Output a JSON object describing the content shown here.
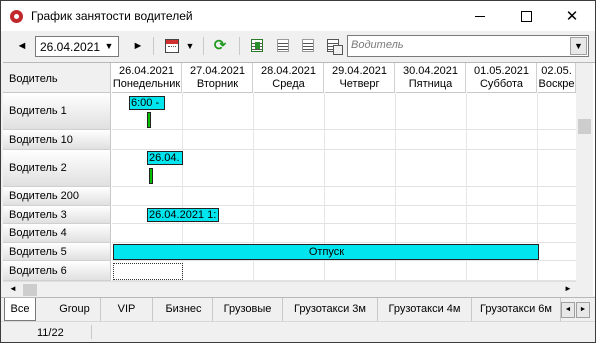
{
  "window": {
    "title": "График занятости водителей",
    "controls": {
      "minimize": "–",
      "maximize": "☐",
      "close": "✕"
    }
  },
  "toolbar": {
    "prev_label": "◄",
    "next_label": "►",
    "date_value": "26.04.2021",
    "dropdown_arrow": "▼",
    "menu_arrow": "▼",
    "refresh_icon": "⟳",
    "driver_filter_placeholder": "Водитель",
    "driver_filter_value": ""
  },
  "schedule": {
    "driver_column_title": "Водитель",
    "days": [
      {
        "date": "26.04.2021",
        "weekday": "Понедельник"
      },
      {
        "date": "27.04.2021",
        "weekday": "Вторник"
      },
      {
        "date": "28.04.2021",
        "weekday": "Среда"
      },
      {
        "date": "29.04.2021",
        "weekday": "Четверг"
      },
      {
        "date": "30.04.2021",
        "weekday": "Пятница"
      },
      {
        "date": "01.05.2021",
        "weekday": "Суббота"
      },
      {
        "date": "02.05.",
        "weekday": "Воскре"
      }
    ],
    "drivers": [
      "Водитель 1",
      "Водитель 10",
      "Водитель 2",
      "Водитель 200",
      "Водитель 3",
      "Водитель 4",
      "Водитель 5",
      "Водитель 6"
    ],
    "events": [
      {
        "driver": "Водитель 1",
        "text": "6:00 -"
      },
      {
        "driver": "Водитель 2",
        "text": "26.04."
      },
      {
        "driver": "Водитель 3",
        "text": "26.04.2021 1:"
      },
      {
        "driver": "Водитель 5",
        "text": "Отпуск"
      }
    ],
    "colors": {
      "event": "#00e5ee",
      "tick": "#00c000"
    }
  },
  "tabs": {
    "items": [
      "Все",
      "Group",
      "VIP",
      "Бизнес",
      "Грузовые",
      "Грузотакси 3м",
      "Грузотакси 4м",
      "Грузотакси 6м"
    ],
    "active": "Все",
    "scroll_left": "◄",
    "scroll_right": "►"
  },
  "status": {
    "record_counter": "11/22"
  }
}
